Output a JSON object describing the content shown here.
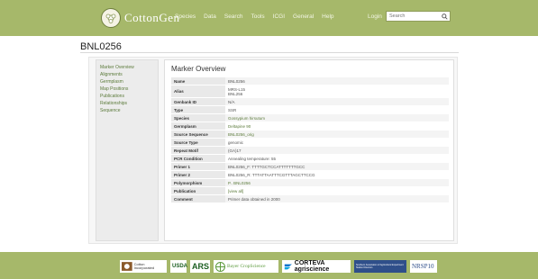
{
  "header": {
    "site_name": "CottonGen",
    "nav": [
      "Species",
      "Data",
      "Search",
      "Tools",
      "ICGI",
      "General",
      "Help"
    ],
    "login_label": "Login",
    "search_placeholder": "Search"
  },
  "page_title": "BNL0256",
  "sidebar": {
    "items": [
      "Marker Overview",
      "Alignments",
      "Germplasm",
      "Map Positions",
      "Publications",
      "Relationships",
      "Sequence"
    ]
  },
  "main": {
    "title": "Marker Overview",
    "rows": [
      {
        "key": "Name",
        "value": "BNL0256"
      },
      {
        "key": "Alias",
        "value": "MRS-L15",
        "value2": "BNL256"
      },
      {
        "key": "Genbank ID",
        "value": "N/A"
      },
      {
        "key": "Type",
        "value": "SSR"
      },
      {
        "key": "Species",
        "value": "Gossypium hirsutum"
      },
      {
        "key": "Germplasm",
        "value": "Deltapine 90"
      },
      {
        "key": "Source Sequence",
        "value": "BNL0256_orig"
      },
      {
        "key": "Source Type",
        "value": "genomic"
      },
      {
        "key": "Repeat Motif",
        "value": "(GA)17"
      },
      {
        "key": "PCR Condition",
        "value": "Annealing temperature: 55"
      },
      {
        "key": "Primer 1",
        "value": "BNL0256_F: TTTTGCTCCATTTTTTTGCC"
      },
      {
        "key": "Primer 2",
        "value": "BNL0256_R: TTTATTAATTTCGTTTAGCTTCCG"
      },
      {
        "key": "Polymorphism",
        "value": "P.. BNL0256"
      },
      {
        "key": "Publication",
        "value": "[view all]"
      },
      {
        "key": "Comment",
        "value": "Primer data obtained in 2000"
      }
    ]
  },
  "footer": {
    "partners": [
      "Cotton Incorporated",
      "USDA",
      "ARS",
      "Bayer CropScience",
      "CORTEVA agriscience",
      "Southern Association of Agricultural Experiment Station Directors",
      "NRSP10"
    ]
  },
  "colors": {
    "header_bg": "#a6b86a",
    "link": "#5b7a3a"
  }
}
